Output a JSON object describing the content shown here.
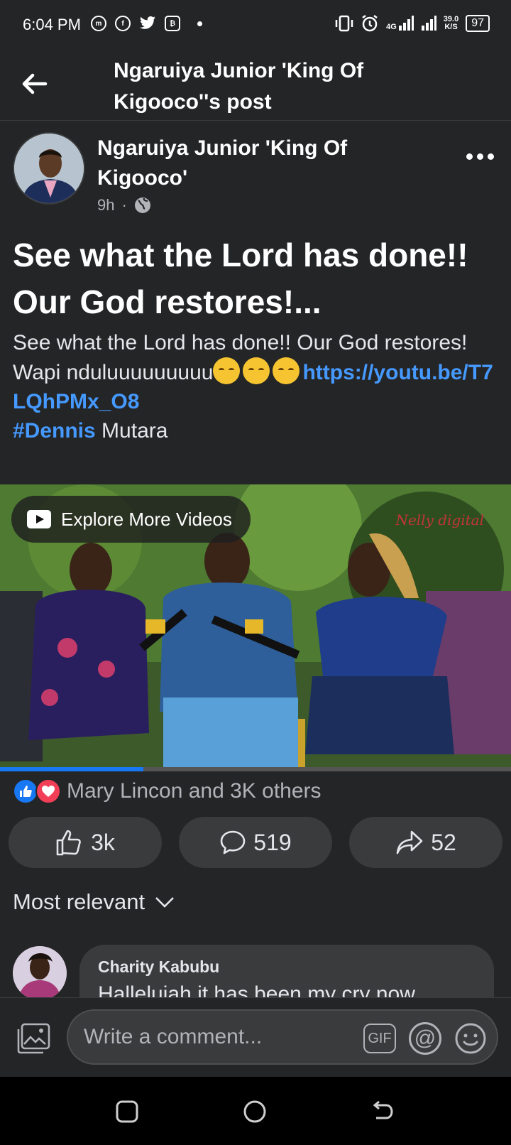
{
  "status_bar": {
    "time": "6:04 PM",
    "left_icons": [
      "messenger-icon",
      "facebook-icon",
      "twitter-icon",
      "bitcoin-icon"
    ],
    "network_label": "4G",
    "speed_value": "39.0",
    "speed_unit": "K/S",
    "battery": "97"
  },
  "header": {
    "title": "Ngaruiya Junior 'King Of Kigooco''s post"
  },
  "post": {
    "author": "Ngaruiya Junior 'King Of Kigooco'",
    "time": "9h",
    "separator": "·",
    "title": "See what the Lord has done!! Our God restores!...",
    "body_line1": "See what the Lord has done!! Our God restores!",
    "body_line2_prefix": "Wapi nduluuuuuuuuu",
    "link": "https://youtu.be/T7LQhPMx_O8",
    "hashtag": "#Dennis",
    "hashtag_rest": " Mutara"
  },
  "video": {
    "explore_label": "Explore More Videos",
    "watermark": "Nelly digital",
    "progress": 0.28
  },
  "reactions": {
    "summary": "Mary Lincon and 3K others"
  },
  "actions": {
    "like_count": "3k",
    "comment_count": "519",
    "share_count": "52"
  },
  "comments": {
    "sort_label": "Most relevant",
    "items": [
      {
        "author": "Charity Kabubu",
        "text": "Halleluiah it has been my cry  now"
      }
    ]
  },
  "composer": {
    "placeholder": "Write a comment...",
    "gif_label": "GIF",
    "at_label": "@"
  },
  "colors": {
    "background": "#242527",
    "surface": "#3a3b3c",
    "accent": "#1877f2",
    "link": "#4599ff",
    "love": "#f33e58"
  }
}
